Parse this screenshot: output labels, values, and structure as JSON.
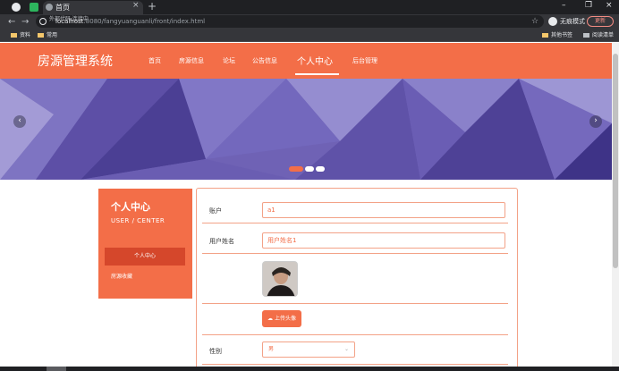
{
  "browser": {
    "tab_title": "首页",
    "url_host": "localhost",
    "url_path": ":8080/fangyuanguanli/front/index.html",
    "status_tag": "外部代码·连接中",
    "incognito_label": "无痕模式",
    "update_label": "更新",
    "bookmarks": [
      "资料",
      "常用"
    ],
    "bookmarks_right": [
      "其他书签",
      "阅读清单"
    ]
  },
  "header": {
    "logo": "房源管理系统",
    "nav": [
      "首页",
      "房源信息",
      "论坛",
      "公告信息",
      "个人中心",
      "后台管理"
    ],
    "active_nav": "个人中心"
  },
  "banner": {
    "prev": "‹",
    "next": "›",
    "slides": 3,
    "active_slide": 1
  },
  "sidebar": {
    "title": "个人中心",
    "subtitle": "USER / CENTER",
    "items": [
      "个人中心",
      "房源收藏"
    ]
  },
  "form": {
    "account_label": "账户",
    "account_value": "a1",
    "name_label": "用户姓名",
    "name_placeholder": "用户姓名1",
    "upload_label": "上传头像",
    "gender_label": "性别",
    "gender_value": "男"
  },
  "colors": {
    "accent": "#f36e48",
    "accent_dark": "#d5472b",
    "border": "#f3a287"
  }
}
